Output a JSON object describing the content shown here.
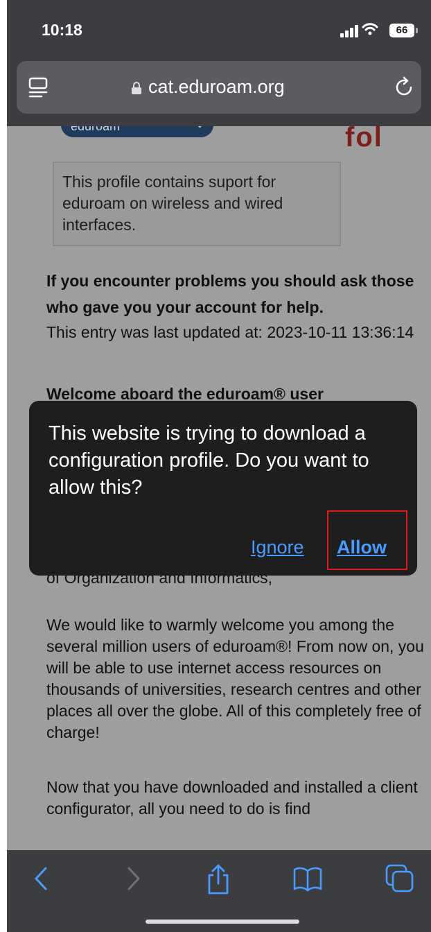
{
  "status_bar": {
    "time": "10:18",
    "battery_level": "66"
  },
  "address_bar": {
    "url": "cat.eduroam.org",
    "reader_icon": "reader-icon",
    "lock_icon": "lock-icon",
    "reload_icon": "reload-icon"
  },
  "page": {
    "dropdown_label": "eduroam",
    "logo_text": "fol",
    "profile_description": "This profile contains suport for eduroam on wireless and wired interfaces.",
    "problems_note": "If you encounter problems you should ask those who gave you your account for help.",
    "last_updated": "This entry was last updated at: 2023-10-11 13:36:14",
    "welcome_heading": "Welcome aboard the eduroam® user",
    "organization_line": "of Organization and Informatics,",
    "welcome_paragraph": "We would like to warmly welcome you among the several million users of eduroam®! From now on, you will be able to use internet access resources on thousands of universities, research centres and other places all over the globe. All of this completely free of charge!",
    "next_paragraph": "Now that you have downloaded and installed a client configurator, all you need to do is find"
  },
  "dialog": {
    "message": "This website is trying to download a configuration profile. Do you want to allow this?",
    "ignore_label": "Ignore",
    "allow_label": "Allow",
    "highlight_color": "#e01a1a"
  },
  "bottom_bar": {
    "icons": [
      "back-icon",
      "forward-icon",
      "share-icon",
      "bookmarks-icon",
      "tabs-icon"
    ],
    "accent_color": "#4a9bff"
  }
}
